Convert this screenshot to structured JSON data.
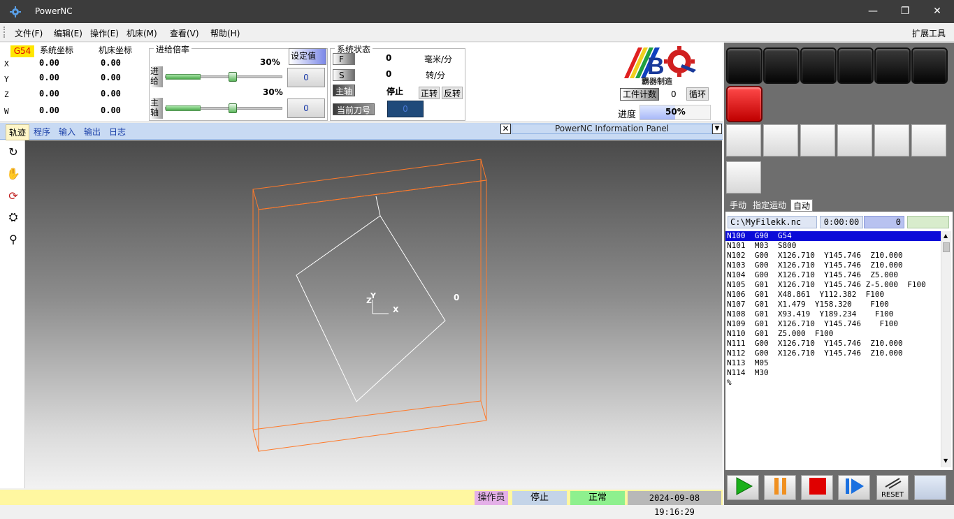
{
  "window": {
    "title": "PowerNC"
  },
  "menu": {
    "items": [
      "文件(F)",
      "编辑(E)",
      "操作(E)",
      "机床(M)",
      "查看(V)",
      "帮助(H)"
    ],
    "right": "扩展工具"
  },
  "coords": {
    "wcs": "G54",
    "sys_label": "系统坐标",
    "mach_label": "机床坐标",
    "rows": [
      {
        "axis": "X",
        "sys": "0.00",
        "mach": "0.00"
      },
      {
        "axis": "Y",
        "sys": "0.00",
        "mach": "0.00"
      },
      {
        "axis": "Z",
        "sys": "0.00",
        "mach": "0.00"
      },
      {
        "axis": "W",
        "sys": "0.00",
        "mach": "0.00"
      }
    ]
  },
  "override": {
    "title": "进给倍率",
    "set_label": "设定值",
    "feed_label": "进给",
    "feed_pct": "30%",
    "feed_value": 30,
    "feed_box": "0",
    "spindle_label": "主轴",
    "spindle_pct": "30%",
    "spindle_value": 30,
    "spindle_box": "0"
  },
  "sysstate": {
    "title": "系统状态",
    "f_label": "F",
    "f_value": "0",
    "f_unit": "毫米/分",
    "s_label": "S",
    "s_value": "0",
    "s_unit": "转/分",
    "spindle_label": "主轴",
    "spindle_state": "停止",
    "cw": "正转",
    "ccw": "反转",
    "tool_label": "当前刀号",
    "tool_value": "0"
  },
  "logo": {
    "caption": "霸器制造"
  },
  "counter": {
    "label": "工件计数",
    "value": "0",
    "loop": "循环"
  },
  "progress": {
    "label": "进度",
    "text": "50%",
    "value": 50
  },
  "tabs": [
    "轨迹",
    "程序",
    "输入",
    "输出",
    "日志"
  ],
  "info_panel": {
    "title": "PowerNC Information Panel"
  },
  "viewport": {
    "label_zero": "0",
    "axis_x": "X",
    "axis_y": "Y",
    "axis_z": "Z"
  },
  "status": {
    "operator": "操作员",
    "state": "停止",
    "health": "正常",
    "datetime": "2024-09-08 19:16:29"
  },
  "right": {
    "tabs": [
      "手动",
      "指定运动",
      "自动"
    ],
    "file": "C:\\MyFilekk.nc",
    "time": "0:00:00",
    "count": "0",
    "gcode": [
      "N100  G90  G54",
      "N101  M03  S800",
      "N102  G00  X126.710  Y145.746  Z10.000",
      "N103  G00  X126.710  Y145.746  Z10.000",
      "N104  G00  X126.710  Y145.746  Z5.000",
      "N105  G01  X126.710  Y145.746 Z-5.000  F100",
      "N106  G01  X48.861  Y112.382  F100",
      "N107  G01  X1.479  Y158.320    F100",
      "N108  G01  X93.419  Y189.234    F100",
      "N109  G01  X126.710  Y145.746    F100",
      "N110  G01  Z5.000  F100",
      "N111  G00  X126.710  Y145.746  Z10.000",
      "N112  G00  X126.710  Y145.746  Z10.000",
      "N113  M05",
      "N114  M30",
      "%"
    ],
    "reset_label": "RESET"
  },
  "colors": {
    "accent": "#0b0bd8",
    "status_green": "#8ef08e",
    "status_yellow": "#fff7a0",
    "path_orange": "#ff7a2a"
  }
}
